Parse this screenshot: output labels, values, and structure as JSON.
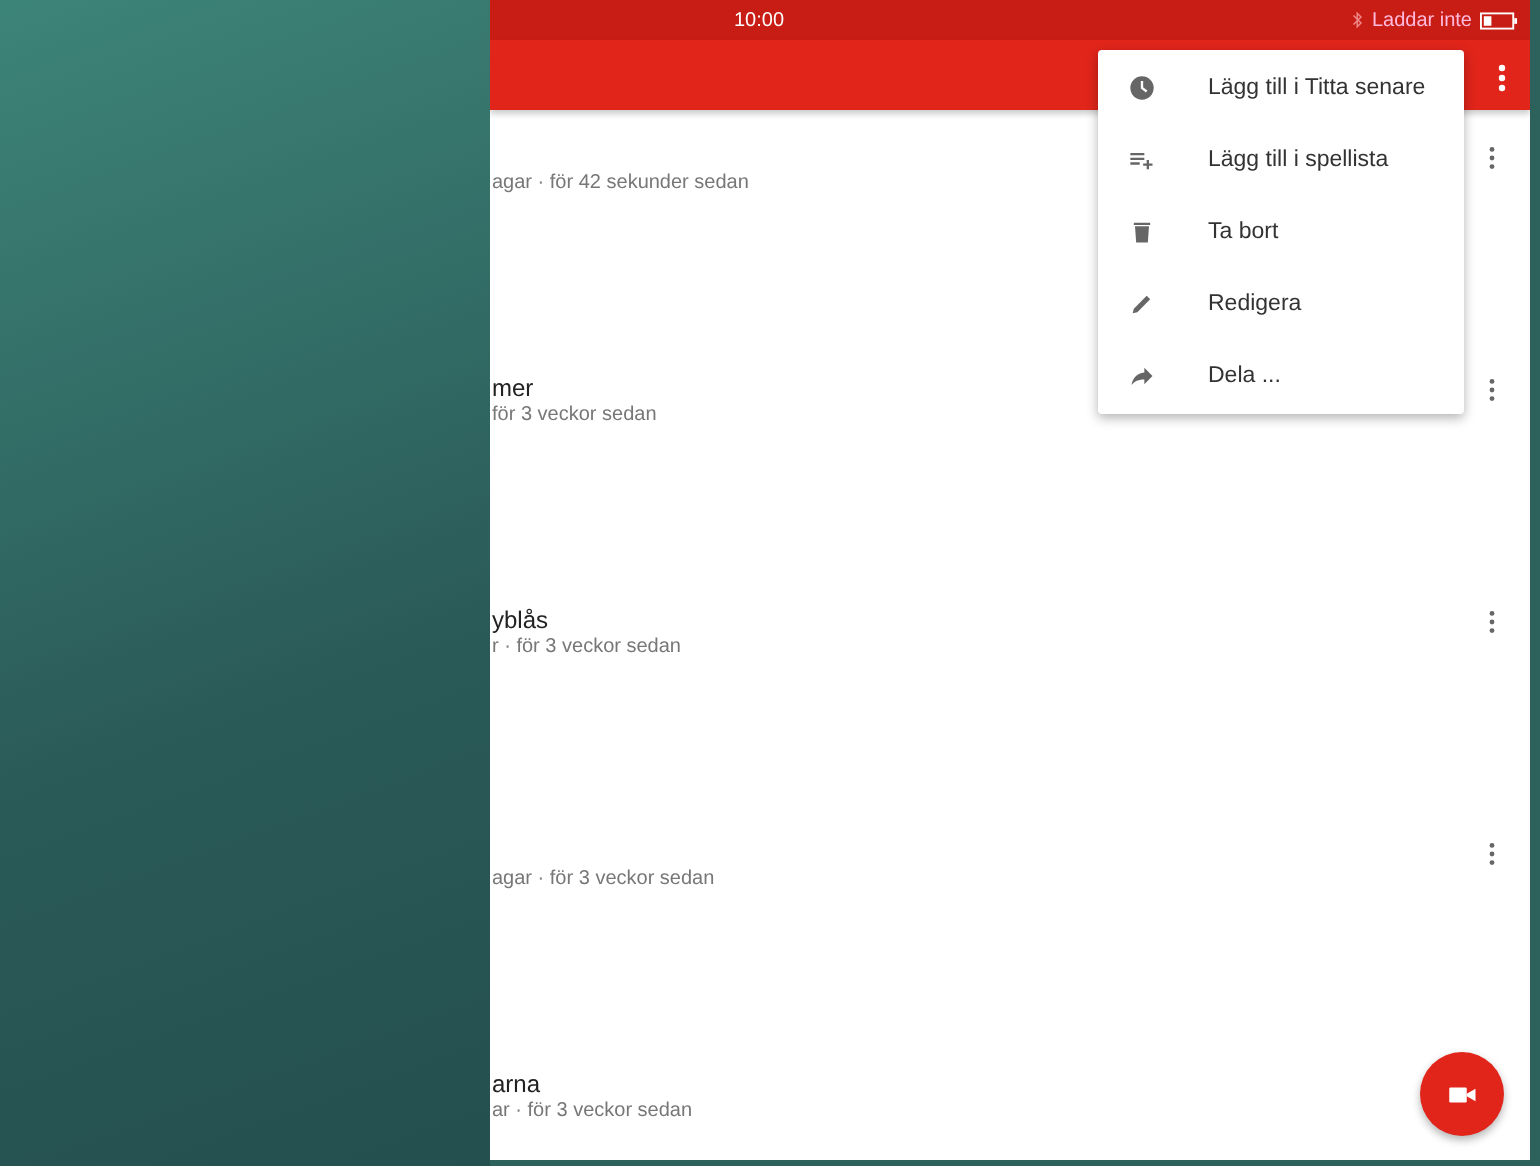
{
  "status_bar": {
    "time": "10:00",
    "charging": "Laddar inte"
  },
  "rows": [
    {
      "title": null,
      "subtitle": "agar · för 42 sekunder sedan"
    },
    {
      "title": "mer",
      "subtitle": "för 3 veckor sedan"
    },
    {
      "title": "yblås",
      "subtitle": "r · för 3 veckor sedan"
    },
    {
      "title": null,
      "subtitle": "agar · för 3 veckor sedan"
    },
    {
      "title": "arna",
      "subtitle": "ar · för 3 veckor sedan"
    }
  ],
  "menu": [
    {
      "kind": "clock",
      "label": "Lägg till i Titta senare"
    },
    {
      "kind": "playlist",
      "label": "Lägg till i spellista"
    },
    {
      "kind": "trash",
      "label": "Ta bort"
    },
    {
      "kind": "pencil",
      "label": "Redigera"
    },
    {
      "kind": "share",
      "label": "Dela ..."
    }
  ]
}
